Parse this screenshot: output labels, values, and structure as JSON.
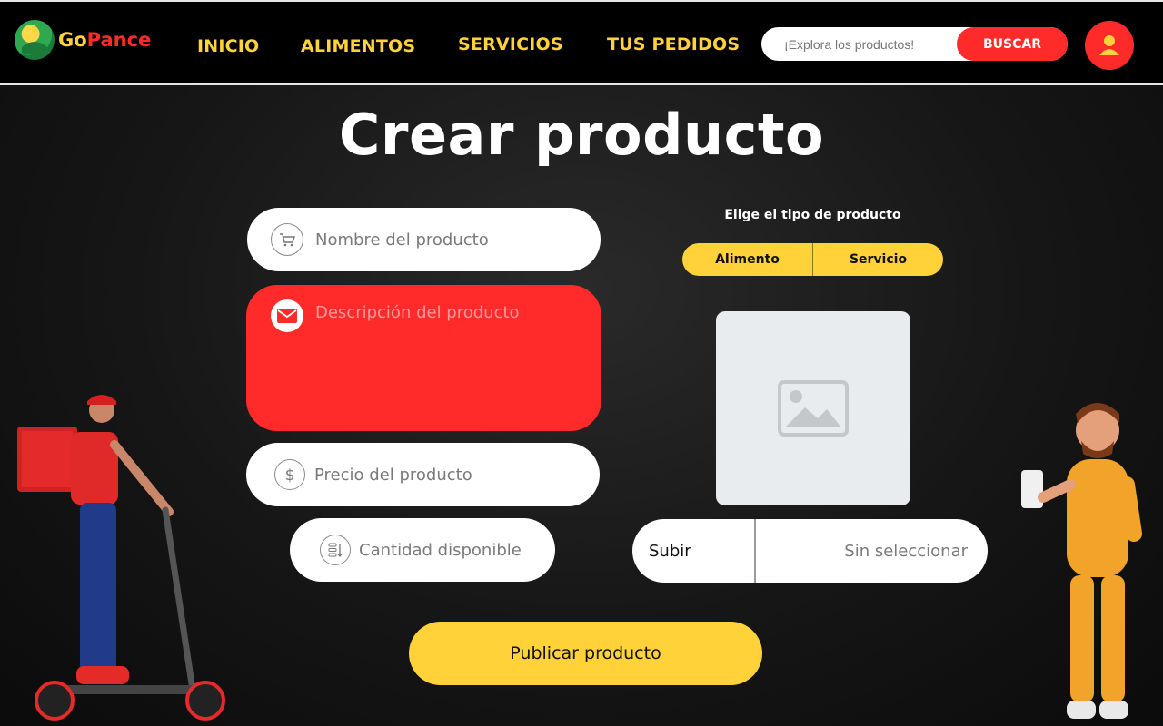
{
  "header": {
    "logo_go": "Go",
    "logo_pance": "Pance",
    "nav": [
      "INICIO",
      "ALIMENTOS",
      "SERVICIOS",
      "TUS PEDIDOS"
    ],
    "search_placeholder": "¡Explora los productos!",
    "search_button": "BUSCAR"
  },
  "main": {
    "title": "Crear producto",
    "fields": {
      "name_placeholder": "Nombre del producto",
      "description_placeholder": "Descripción del producto",
      "price_placeholder": "Precio del producto",
      "quantity_placeholder": "Cantidad disponible"
    },
    "type_label": "Elige el tipo de producto",
    "type_options": [
      "Alimento",
      "Servicio"
    ],
    "upload_button": "Subir",
    "upload_status": "Sin seleccionar",
    "publish_button": "Publicar producto"
  },
  "colors": {
    "accent_yellow": "#ffd23a",
    "accent_red": "#ff2b2b",
    "header_bg": "#000000"
  },
  "icons": [
    "logo-icon",
    "user-icon",
    "cart-icon",
    "mail-icon",
    "dollar-icon",
    "quantity-icon",
    "image-placeholder-icon"
  ]
}
